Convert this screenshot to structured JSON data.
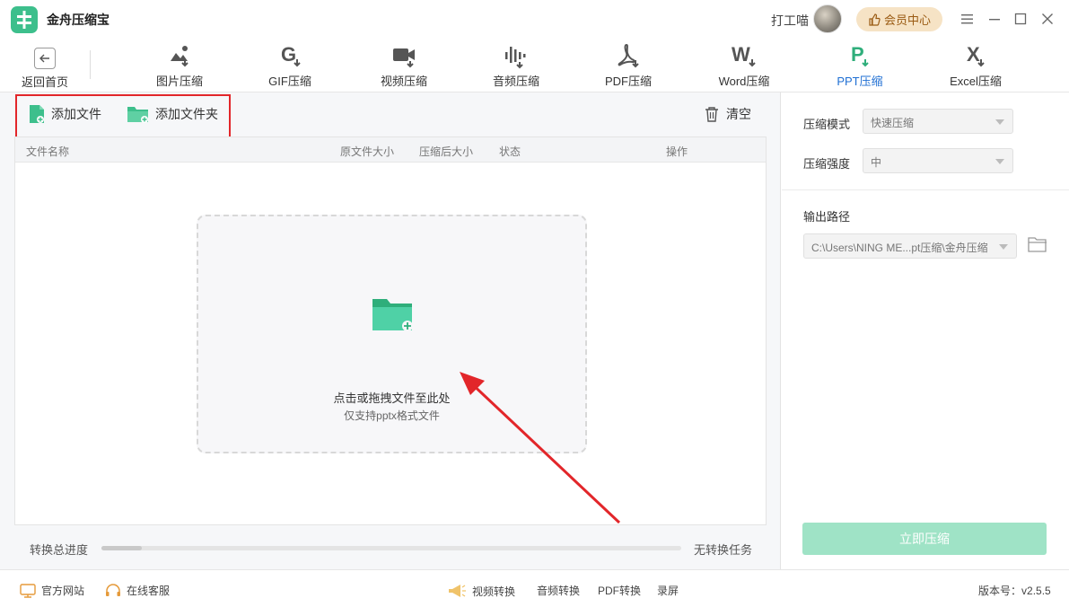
{
  "app": {
    "name": "金舟压缩宝"
  },
  "user": {
    "name": "打工喵",
    "vip_label": "会员中心"
  },
  "window_controls": [
    "menu-icon",
    "minimize-icon",
    "maximize-icon",
    "close-icon"
  ],
  "toolbar": {
    "back_label": "返回首页",
    "tools": [
      {
        "label": "图片压缩",
        "icon": "image-compress-icon",
        "letter": ""
      },
      {
        "label": "GIF压缩",
        "icon": "gif-compress-icon",
        "letter": "G"
      },
      {
        "label": "视频压缩",
        "icon": "video-compress-icon",
        "letter": ""
      },
      {
        "label": "音频压缩",
        "icon": "audio-compress-icon",
        "letter": ""
      },
      {
        "label": "PDF压缩",
        "icon": "pdf-compress-icon",
        "letter": ""
      },
      {
        "label": "Word压缩",
        "icon": "word-compress-icon",
        "letter": "W"
      },
      {
        "label": "PPT压缩",
        "icon": "ppt-compress-icon",
        "letter": "P",
        "active": true
      },
      {
        "label": "Excel压缩",
        "icon": "excel-compress-icon",
        "letter": "X"
      }
    ]
  },
  "actions": {
    "add_file": "添加文件",
    "add_folder": "添加文件夹",
    "clear": "清空"
  },
  "table": {
    "headers": {
      "name": "文件名称",
      "orig_size": "原文件大小",
      "new_size": "压缩后大小",
      "status": "状态",
      "ops": "操作"
    }
  },
  "dropzone": {
    "title": "点击或拖拽文件至此处",
    "subtitle": "仅支持pptx格式文件"
  },
  "progress": {
    "label": "转换总进度",
    "status": "无转换任务",
    "fraction": 0.07
  },
  "settings": {
    "mode_label": "压缩模式",
    "mode_value": "快速压缩",
    "strength_label": "压缩强度",
    "strength_value": "中",
    "output_label": "输出路径",
    "output_value": "C:\\Users\\NING ME...pt压缩\\金舟压缩",
    "compress_button": "立即压缩"
  },
  "footer": {
    "website": "官方网站",
    "service": "在线客服",
    "video": "视频转换",
    "audio": "音频转换",
    "pdf": "PDF转换",
    "record": "录屏",
    "version_label": "版本号：",
    "version": "v2.5.5"
  },
  "colors": {
    "brand": "#3dbf8c",
    "active_tab": "#1f6fd3",
    "highlight": "#e2262a",
    "button_disabled": "#9fe3c6"
  }
}
